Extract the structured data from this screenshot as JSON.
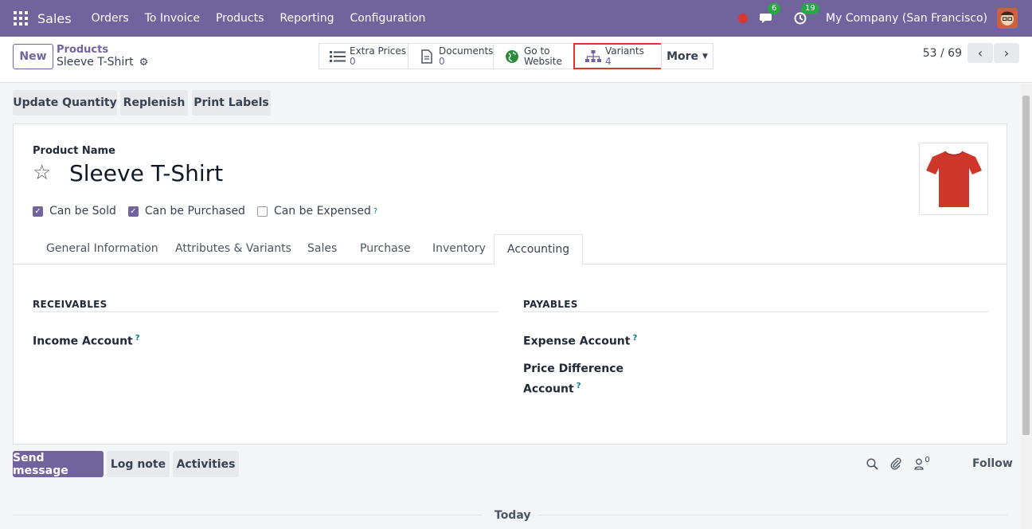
{
  "navbar": {
    "brand": "Sales",
    "menu": [
      "Orders",
      "To Invoice",
      "Products",
      "Reporting",
      "Configuration"
    ],
    "messages_count": "6",
    "activities_count": "19",
    "company": "My Company (San Francisco)"
  },
  "control": {
    "new_label": "New",
    "breadcrumb": "Products",
    "record_name": "Sleeve T-Shirt",
    "smart_buttons": {
      "extra_prices": {
        "label": "Extra Prices",
        "value": "0"
      },
      "documents": {
        "label": "Documents",
        "value": "0"
      },
      "website": {
        "line1": "Go to",
        "line2": "Website"
      },
      "variants": {
        "label": "Variants",
        "value": "4"
      },
      "more": "More"
    },
    "pager": "53 / 69"
  },
  "actions": {
    "update_quantity": "Update Quantity",
    "replenish": "Replenish",
    "print_labels": "Print Labels"
  },
  "form": {
    "product_name_label": "Product Name",
    "product_name": "Sleeve T-Shirt",
    "can_be_sold": "Can be Sold",
    "can_be_purchased": "Can be Purchased",
    "can_be_expensed": "Can be Expensed",
    "help_mark": "?",
    "tabs": [
      "General Information",
      "Attributes & Variants",
      "Sales",
      "Purchase",
      "Inventory",
      "Accounting"
    ],
    "receivables_title": "RECEIVABLES",
    "payables_title": "PAYABLES",
    "income_account": "Income Account",
    "expense_account": "Expense Account",
    "price_diff_line1": "Price Difference",
    "price_diff_line2": "Account"
  },
  "chatter": {
    "send_message": "Send message",
    "log_note": "Log note",
    "activities": "Activities",
    "followers_count": "0",
    "follow": "Follow",
    "today": "Today"
  },
  "colors": {
    "brand": "#71639e",
    "badge": "#28a745",
    "highlight": "#d9382f",
    "tshirt": "#d0372b"
  }
}
